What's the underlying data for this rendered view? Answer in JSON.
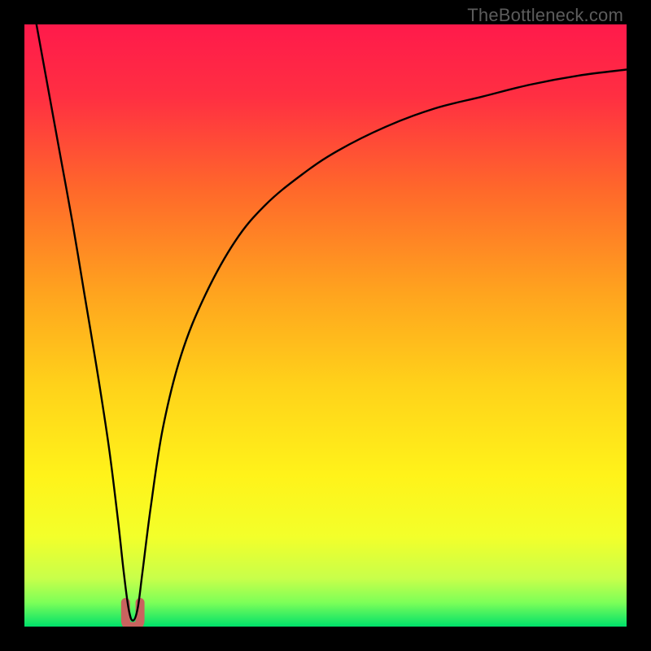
{
  "watermark": {
    "text": "TheBottleneck.com"
  },
  "chart_data": {
    "type": "line",
    "title": "",
    "xlabel": "",
    "ylabel": "",
    "ylim": [
      0,
      100
    ],
    "xlim": [
      0,
      100
    ],
    "legend": false,
    "grid": false,
    "gradient_stops": [
      {
        "pct": 0,
        "color": "#ff1a4b"
      },
      {
        "pct": 12,
        "color": "#ff2f42"
      },
      {
        "pct": 28,
        "color": "#ff6a2a"
      },
      {
        "pct": 45,
        "color": "#ffa51e"
      },
      {
        "pct": 60,
        "color": "#ffd21a"
      },
      {
        "pct": 75,
        "color": "#fff31a"
      },
      {
        "pct": 85,
        "color": "#f3ff2a"
      },
      {
        "pct": 92,
        "color": "#c8ff4a"
      },
      {
        "pct": 96,
        "color": "#7dff58"
      },
      {
        "pct": 100,
        "color": "#00e06a"
      }
    ],
    "series": [
      {
        "name": "bottleneck-curve",
        "stroke": "#000000",
        "x": [
          2,
          4,
          6,
          8,
          10,
          12,
          14,
          15.5,
          16.5,
          17.3,
          18,
          18.8,
          19.6,
          21,
          23,
          26,
          30,
          35,
          40,
          46,
          52,
          60,
          68,
          76,
          84,
          92,
          100
        ],
        "y": [
          100,
          89,
          78,
          67,
          55,
          43,
          30,
          18,
          9,
          3,
          1,
          3,
          9,
          20,
          33,
          45,
          55,
          64,
          70,
          75,
          79,
          83,
          86,
          88,
          90,
          91.5,
          92.5
        ]
      }
    ],
    "marker": {
      "name": "sweet-spot-marker",
      "color": "#c9635f",
      "x_range": [
        16.8,
        19.2
      ],
      "y_range": [
        0,
        4
      ]
    }
  }
}
